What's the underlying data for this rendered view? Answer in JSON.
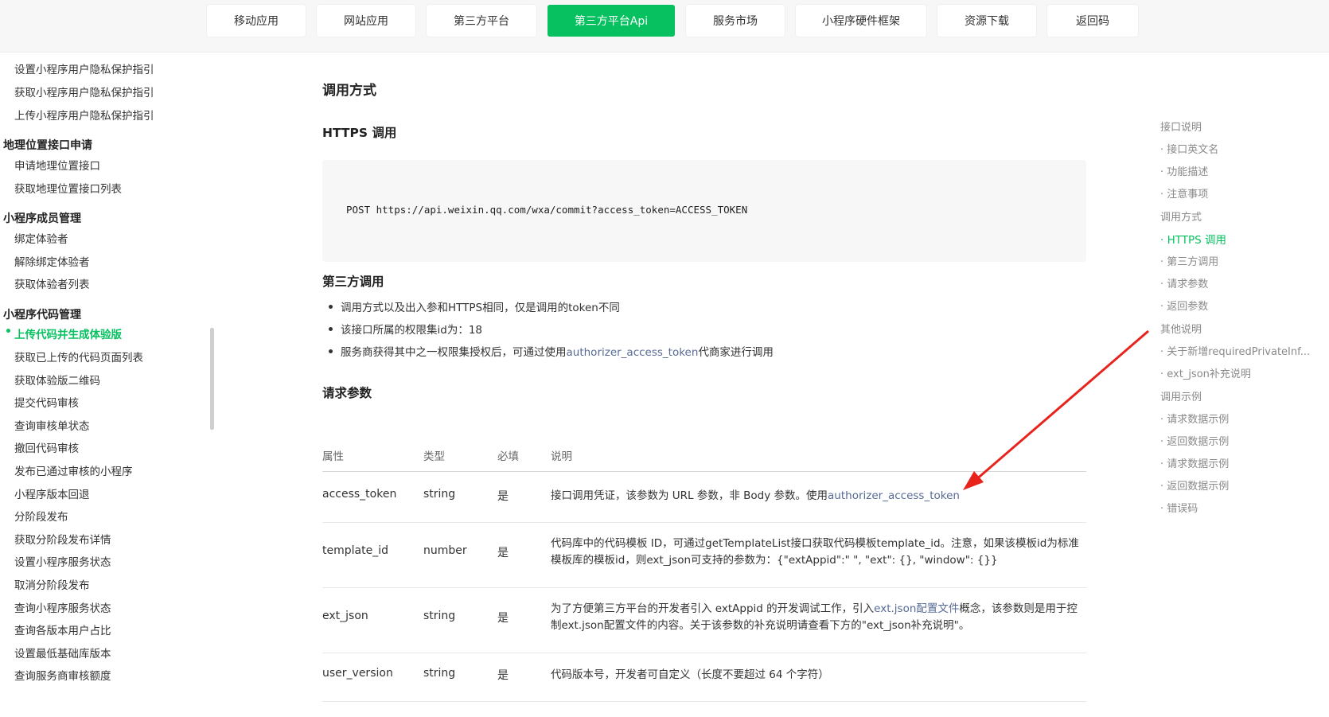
{
  "topnav": {
    "items": [
      {
        "label": "移动应用"
      },
      {
        "label": "网站应用"
      },
      {
        "label": "第三方平台"
      },
      {
        "label": "第三方平台Api"
      },
      {
        "label": "服务市场"
      },
      {
        "label": "小程序硬件框架"
      },
      {
        "label": "资源下载"
      },
      {
        "label": "返回码"
      }
    ],
    "active_index": 3,
    "accent": "#07c160"
  },
  "sidebar": {
    "entries": [
      {
        "label": "设置小程序用户隐私保护指引",
        "kind": "item"
      },
      {
        "label": "获取小程序用户隐私保护指引",
        "kind": "item"
      },
      {
        "label": "上传小程序用户隐私保护指引",
        "kind": "item"
      },
      {
        "label": "地理位置接口申请",
        "kind": "group"
      },
      {
        "label": "申请地理位置接口",
        "kind": "item"
      },
      {
        "label": "获取地理位置接口列表",
        "kind": "item"
      },
      {
        "label": "小程序成员管理",
        "kind": "group"
      },
      {
        "label": "绑定体验者",
        "kind": "item"
      },
      {
        "label": "解除绑定体验者",
        "kind": "item"
      },
      {
        "label": "获取体验者列表",
        "kind": "item"
      },
      {
        "label": "小程序代码管理",
        "kind": "group"
      },
      {
        "label": "上传代码并生成体验版",
        "kind": "active"
      },
      {
        "label": "获取已上传的代码页面列表",
        "kind": "item"
      },
      {
        "label": "获取体验版二维码",
        "kind": "item"
      },
      {
        "label": "提交代码审核",
        "kind": "item"
      },
      {
        "label": "查询审核单状态",
        "kind": "item"
      },
      {
        "label": "撤回代码审核",
        "kind": "item"
      },
      {
        "label": "发布已通过审核的小程序",
        "kind": "item"
      },
      {
        "label": "小程序版本回退",
        "kind": "item"
      },
      {
        "label": "分阶段发布",
        "kind": "item"
      },
      {
        "label": "获取分阶段发布详情",
        "kind": "item"
      },
      {
        "label": "设置小程序服务状态",
        "kind": "item"
      },
      {
        "label": "取消分阶段发布",
        "kind": "item"
      },
      {
        "label": "查询小程序服务状态",
        "kind": "item"
      },
      {
        "label": "查询各版本用户占比",
        "kind": "item"
      },
      {
        "label": "设置最低基础库版本",
        "kind": "item"
      },
      {
        "label": "查询服务商审核额度",
        "kind": "item"
      }
    ],
    "active_bullet": "•"
  },
  "main": {
    "section_title": "调用方式",
    "https_title": "HTTPS 调用",
    "code": "POST https://api.weixin.qq.com/wxa/commit?access_token=ACCESS_TOKEN",
    "third_title": "第三方调用",
    "bullets": {
      "b1": "调用方式以及出入参和HTTPS相同，仅是调用的token不同",
      "b2": "该接口所属的权限集id为：18",
      "b3_pre": "服务商获得其中之一权限集授权后，可通过使用",
      "b3_link": "authorizer_access_token",
      "b3_post": "代商家进行调用"
    },
    "params_title": "请求参数",
    "table": {
      "headers": {
        "attr": "属性",
        "type": "类型",
        "required": "必填",
        "desc": "说明"
      },
      "rows": [
        {
          "attr": "access_token",
          "type": "string",
          "required": "是",
          "desc_pre": "接口调用凭证，该参数为 URL 参数，非 Body 参数。使用",
          "desc_link": "authorizer_access_token",
          "desc_post": ""
        },
        {
          "attr": "template_id",
          "type": "number",
          "required": "是",
          "desc_pre": "代码库中的代码模板 ID，可通过getTemplateList接口获取代码模板template_id。注意，如果该模板id为标准模板库的模板id，则ext_json可支持的参数为：{\"extAppid\":\" \", \"ext\": {}, \"window\": {}}",
          "desc_link": "",
          "desc_post": ""
        },
        {
          "attr": "ext_json",
          "type": "string",
          "required": "是",
          "desc_pre": "为了方便第三方平台的开发者引入 extAppid 的开发调试工作，引入",
          "desc_link": "ext.json配置文件",
          "desc_post": "概念，该参数则是用于控制ext.json配置文件的内容。关于该参数的补充说明请查看下方的\"ext_json补充说明\"。"
        },
        {
          "attr": "user_version",
          "type": "string",
          "required": "是",
          "desc_pre": "代码版本号，开发者可自定义（长度不要超过 64 个字符）",
          "desc_link": "",
          "desc_post": ""
        }
      ]
    },
    "link_color": "#576b95"
  },
  "toc": {
    "items": [
      {
        "label": "接口说明",
        "level": 1
      },
      {
        "label": "· 接口英文名",
        "level": 2
      },
      {
        "label": "· 功能描述",
        "level": 2
      },
      {
        "label": "· 注意事项",
        "level": 2
      },
      {
        "label": "调用方式",
        "level": 1
      },
      {
        "label": "· HTTPS 调用",
        "level": 2,
        "active": true
      },
      {
        "label": "· 第三方调用",
        "level": 2
      },
      {
        "label": "· 请求参数",
        "level": 2
      },
      {
        "label": "· 返回参数",
        "level": 2
      },
      {
        "label": "其他说明",
        "level": 1
      },
      {
        "label": "· 关于新增requiredPrivateInf...",
        "level": 2
      },
      {
        "label": "· ext_json补充说明",
        "level": 2
      },
      {
        "label": "调用示例",
        "level": 1
      },
      {
        "label": "· 请求数据示例",
        "level": 2
      },
      {
        "label": "· 返回数据示例",
        "level": 2
      },
      {
        "label": "· 请求数据示例",
        "level": 2
      },
      {
        "label": "· 返回数据示例",
        "level": 2
      },
      {
        "label": "· 错误码",
        "level": 2
      }
    ]
  },
  "annotation": {
    "arrow_color": "#e8231b"
  }
}
